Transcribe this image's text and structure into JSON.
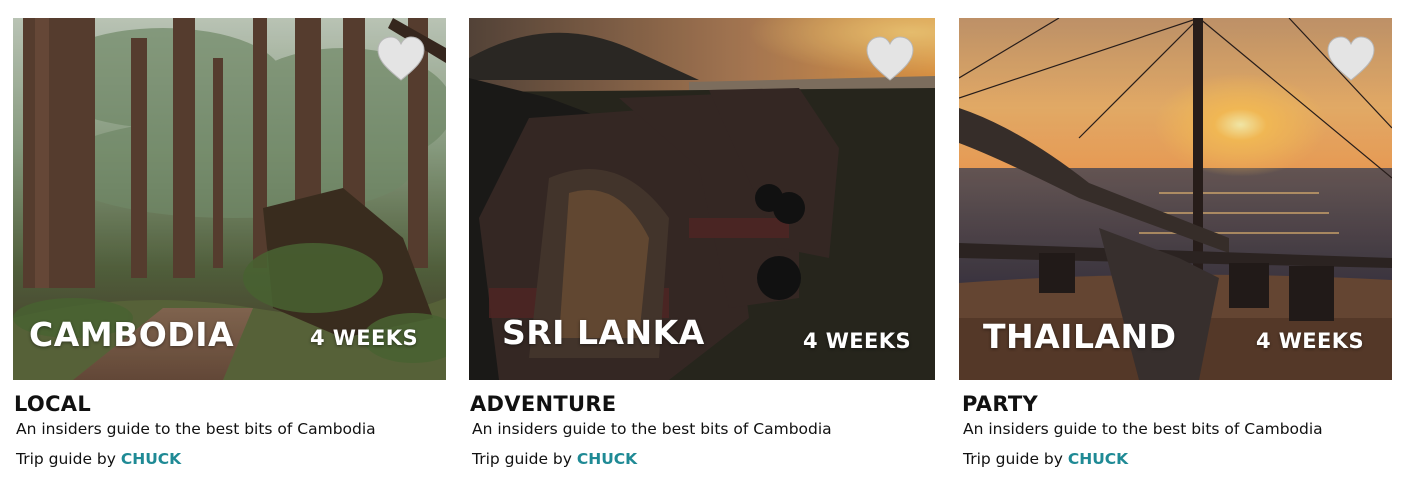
{
  "cards": [
    {
      "country": "CAMBODIA",
      "duration": "4 WEEKS",
      "category": "LOCAL",
      "description": "An insiders guide to the best bits of Cambodia",
      "byline_prefix": "Trip guide by",
      "author": "CHUCK",
      "image": "forest-trail-photo"
    },
    {
      "country": "SRI LANKA",
      "duration": "4 WEEKS",
      "category": "ADVENTURE",
      "description": "An insiders guide to the best bits of Cambodia",
      "byline_prefix": "Trip guide by",
      "author": "CHUCK",
      "image": "tuk-tuks-at-sunset-photo"
    },
    {
      "country": "THAILAND",
      "duration": "4 WEEKS",
      "category": "PARTY",
      "description": "An insiders guide to the best bits of Cambodia",
      "byline_prefix": "Trip guide by",
      "author": "CHUCK",
      "image": "catamaran-beach-sunset-photo"
    }
  ],
  "colors": {
    "author_link": "#1f8a95",
    "heart_fill": "#e4e4e4",
    "text": "#111111"
  },
  "icons": {
    "favorite": "heart-icon"
  }
}
